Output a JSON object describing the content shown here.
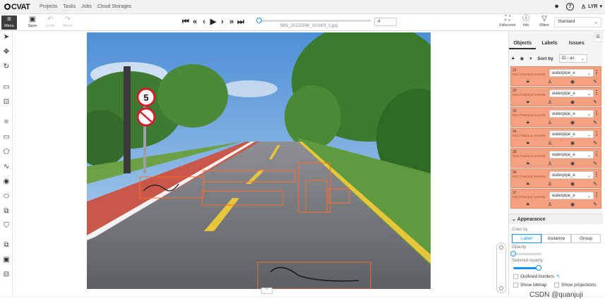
{
  "nav": {
    "logo": "CVAT",
    "links": [
      "Projects",
      "Tasks",
      "Jobs",
      "Cloud Storages"
    ],
    "user": "LYR"
  },
  "toolbar": {
    "menu_label": "Menu",
    "save_label": "Save",
    "undo_label": "Undo",
    "redo_label": "Redo",
    "filename": "IMG_20220506_101003_1.jpg",
    "frame_number": "4",
    "fullscreen_label": "Fullscreen",
    "info_label": "Info",
    "filters_label": "Filters",
    "workspace": "Standard"
  },
  "sidebar": {
    "tabs": [
      "Objects",
      "Labels",
      "Issues"
    ],
    "sort_label": "Sort by",
    "sort_value": "ID - as",
    "objects": [
      {
        "id": "31",
        "type": "RECTANGLE SHAPE",
        "label": "waterpipe_e"
      },
      {
        "id": "32",
        "type": "RECTANGLE SHAPE",
        "label": "waterpipe_e"
      },
      {
        "id": "33",
        "type": "RECTANGLE SHAPE",
        "label": "waterpipe_e"
      },
      {
        "id": "34",
        "type": "RECTANGLE SHAPE",
        "label": "waterpipe_e"
      },
      {
        "id": "35",
        "type": "RECTANGLE SHAPE",
        "label": "waterpipe_e"
      },
      {
        "id": "36",
        "type": "RECTANGLE SHAPE",
        "label": "waterpipe_e"
      },
      {
        "id": "37",
        "type": "RECTANGLE SHAPE",
        "label": "waterpipe_e"
      }
    ]
  },
  "appearance": {
    "title": "Appearance",
    "color_by_label": "Color by",
    "color_options": [
      "Label",
      "Instance",
      "Group"
    ],
    "opacity_label": "Opacity",
    "opacity_value": 0.0,
    "selected_opacity_label": "Selected opacity",
    "selected_opacity_value": 0.9,
    "outlined_borders_label": "Outlined borders",
    "show_bitmap_label": "Show bitmap",
    "show_projections_label": "Show projections"
  },
  "watermark": "CSDN @quanjuji",
  "colors": {
    "object_item_bg": "#f4a182",
    "annotation_box": "#ff6a2b",
    "accent": "#1890ff"
  }
}
